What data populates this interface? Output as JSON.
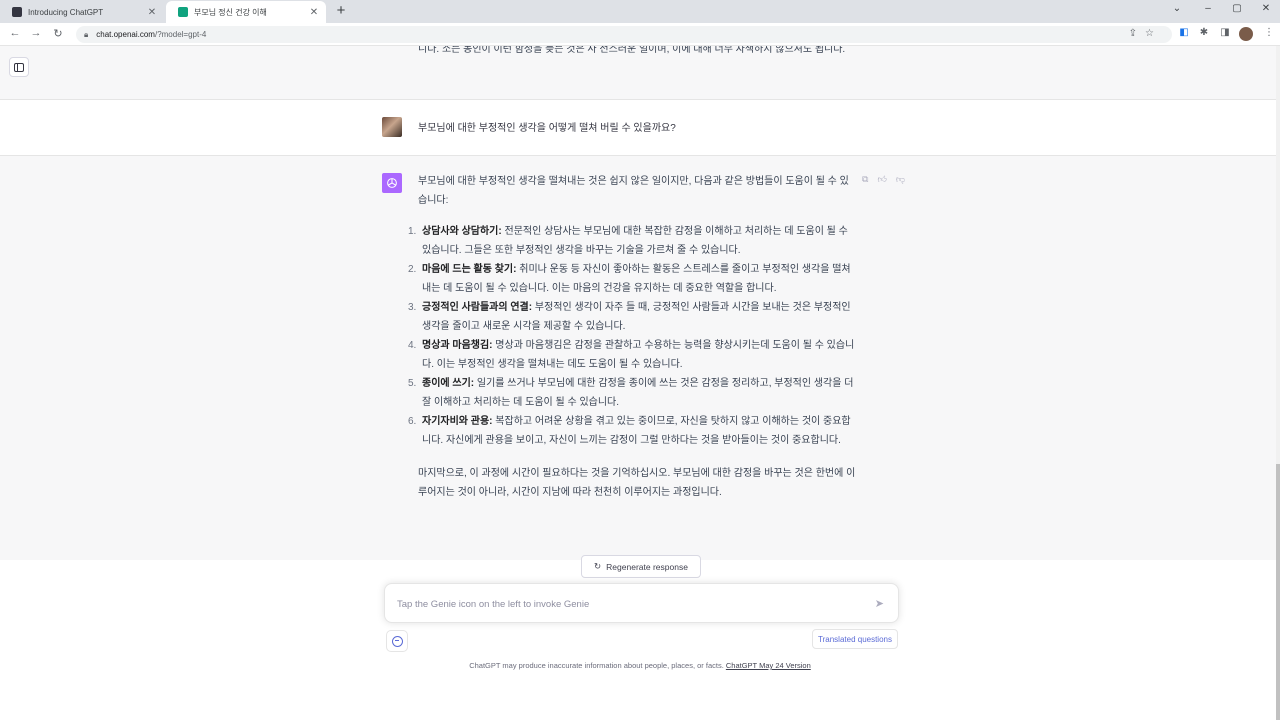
{
  "browser": {
    "tabs": [
      {
        "title": "Introducing ChatGPT",
        "favicon_color": "#343541",
        "active": false
      },
      {
        "title": "부모님 정신 건강 이해",
        "favicon_color": "#10a37f",
        "active": true
      }
    ],
    "url_host": "chat.openai.com",
    "url_path": "/?model=gpt-4"
  },
  "conversation": {
    "previous_answer_tail": "니다. 소는 농인이 이런 함정을 늦는 것은 사 전스러운 일이며, 이에 대해 너무 자책하지 않으셔도 됩니다.",
    "user_question": "부모님에 대한 부정적인 생각을 어떻게 떨쳐 버릴 수 있을까요?",
    "answer": {
      "intro": "부모님에 대한 부정적인 생각을 떨쳐내는 것은 쉽지 않은 일이지만, 다음과 같은 방법들이 도움이 될 수 있습니다:",
      "items": [
        {
          "num": "1.",
          "title": "상담사와 상담하기:",
          "text": " 전문적인 상담사는 부모님에 대한 복잡한 감정을 이해하고 처리하는 데 도움이 될 수 있습니다. 그들은 또한 부정적인 생각을 바꾸는 기술을 가르쳐 줄 수 있습니다."
        },
        {
          "num": "2.",
          "title": "마음에 드는 활동 찾기:",
          "text": " 취미나 운동 등 자신이 좋아하는 활동은 스트레스를 줄이고 부정적인 생각을 떨쳐내는 데 도움이 될 수 있습니다. 이는 마음의 건강을 유지하는 데 중요한 역할을 합니다."
        },
        {
          "num": "3.",
          "title": "긍정적인 사람들과의 연결:",
          "text": " 부정적인 생각이 자주 들 때, 긍정적인 사람들과 시간을 보내는 것은 부정적인 생각을 줄이고 새로운 시각을 제공할 수 있습니다."
        },
        {
          "num": "4.",
          "title": "명상과 마음챙김:",
          "text": " 명상과 마음챙김은 감정을 관찰하고 수용하는 능력을 향상시키는데 도움이 될 수 있습니다. 이는 부정적인 생각을 떨쳐내는 데도 도움이 될 수 있습니다."
        },
        {
          "num": "5.",
          "title": "종이에 쓰기:",
          "text": " 일기를 쓰거나 부모님에 대한 감정을 종이에 쓰는 것은 감정을 정리하고, 부정적인 생각을 더 잘 이해하고 처리하는 데 도움이 될 수 있습니다."
        },
        {
          "num": "6.",
          "title": "자기자비와 관용:",
          "text": " 복잡하고 어려운 상황을 겪고 있는 중이므로, 자신을 탓하지 않고 이해하는 것이 중요합니다. 자신에게 관용을 보이고, 자신이 느끼는 감정이 그럴 만하다는 것을 받아들이는 것이 중요합니다."
        }
      ],
      "conclusion": "마지막으로, 이 과정에 시간이 필요하다는 것을 기억하십시오. 부모님에 대한 감정을 바꾸는 것은 한번에 이루어지는 것이 아니라, 시간이 지남에 따라 천천히 이루어지는 과정입니다."
    }
  },
  "controls": {
    "regenerate_label": "Regenerate response",
    "composer_placeholder": "Tap the Genie icon on the left to invoke Genie",
    "translated_label": "Translated questions"
  },
  "footer": {
    "text": "ChatGPT may produce inaccurate information about people, places, or facts. ",
    "link": "ChatGPT May 24 Version"
  },
  "colors": {
    "gpt_avatar": "#ab68ff",
    "genie_accent": "#5b6bd6"
  }
}
